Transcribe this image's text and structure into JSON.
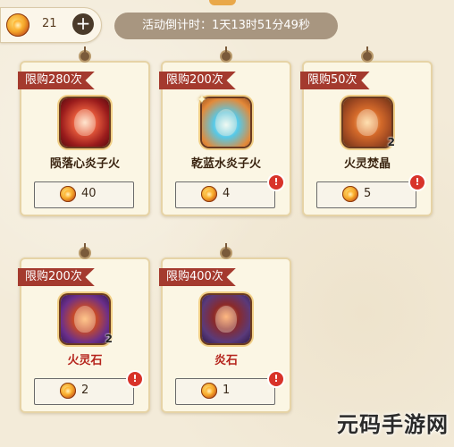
{
  "header": {
    "currency_amount": "21",
    "plus_symbol": "+",
    "timer_text": "活动倒计时：1天13时51分49秒"
  },
  "items": [
    {
      "limit": "限购280次",
      "name": "陨落心炎子火",
      "price": "40",
      "quantity": "",
      "alert": false,
      "icon": "fire-dragon-icon",
      "color_class": "red"
    },
    {
      "limit": "限购200次",
      "name": "乾蓝水炎子火",
      "price": "4",
      "quantity": "",
      "alert": true,
      "icon": "blue-flame-icon",
      "color_class": "blue"
    },
    {
      "limit": "限购50次",
      "name": "火灵焚晶",
      "price": "5",
      "quantity": "2",
      "alert": true,
      "icon": "fire-crystal-icon",
      "color_class": "orange"
    },
    {
      "limit": "限购200次",
      "name": "火灵石",
      "price": "2",
      "quantity": "2",
      "alert": true,
      "icon": "fire-spirit-stone-icon",
      "color_class": "purple"
    },
    {
      "limit": "限购400次",
      "name": "炎石",
      "price": "1",
      "quantity": "",
      "alert": true,
      "icon": "flame-stone-icon",
      "color_class": "purple2"
    }
  ],
  "alert_symbol": "!",
  "watermark": "元码手游网"
}
